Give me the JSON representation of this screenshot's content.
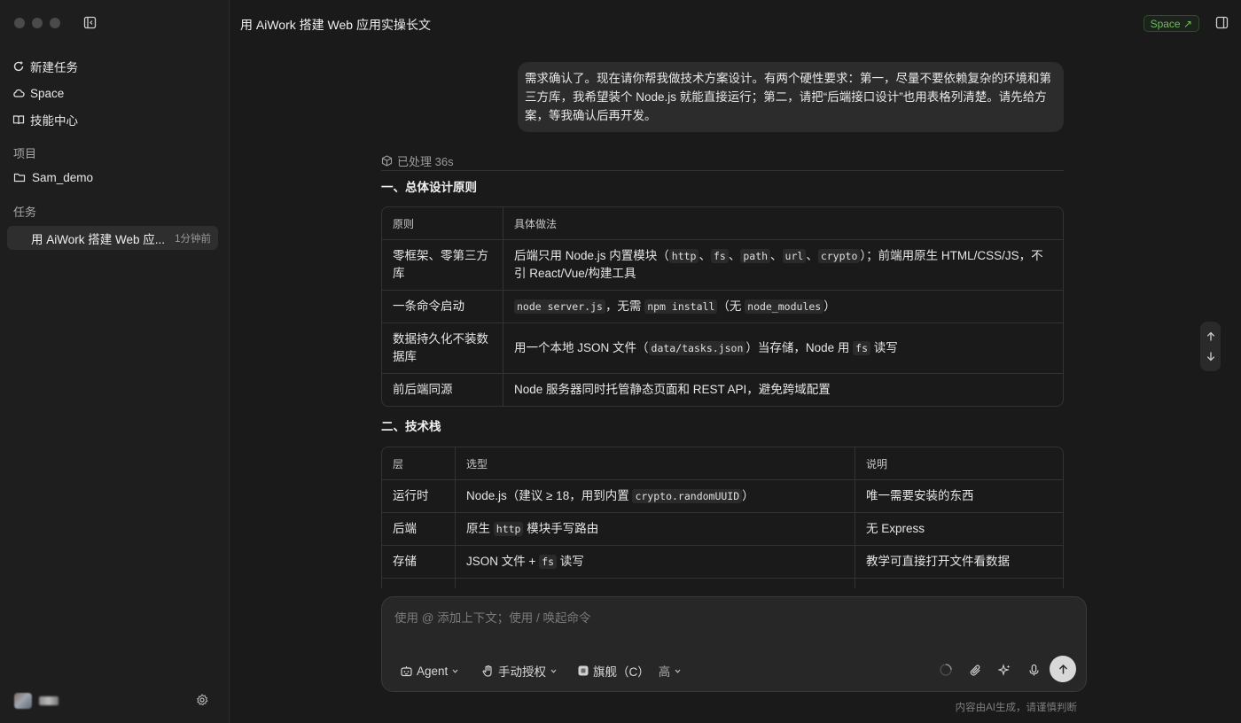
{
  "sidebar": {
    "nav": [
      {
        "label": "新建任务",
        "icon": "new-task-icon"
      },
      {
        "label": "Space",
        "icon": "cloud-icon"
      },
      {
        "label": "技能中心",
        "icon": "book-icon"
      }
    ],
    "projects_label": "项目",
    "project": "Sam_demo",
    "tasks_label": "任务",
    "task": {
      "title": "用 AiWork 搭建 Web 应...",
      "time": "1分钟前"
    }
  },
  "header": {
    "title": "用 AiWork 搭建 Web 应用实操长文",
    "space_label": "Space ↗"
  },
  "chat": {
    "user_message": "需求确认了。现在请你帮我做技术方案设计。有两个硬性要求：第一，尽量不要依赖复杂的环境和第三方库，我希望装个 Node.js 就能直接运行；第二，请把“后端接口设计”也用表格列清楚。请先给方案，等我确认后再开发。",
    "processed": "已处理 36s",
    "section1_title": "一、总体设计原则",
    "table1": {
      "headers": [
        "原则",
        "具体做法"
      ],
      "rows": [
        {
          "c0": "零框架、零第三方库",
          "p1": "后端只用 Node.js 内置模块（",
          "k1": "http",
          "s1": "、",
          "k2": "fs",
          "s2": "、",
          "k3": "path",
          "s3": "、",
          "k4": "url",
          "s4": "、",
          "k5": "crypto",
          "p2": "）；前端用原生 HTML/CSS/JS，不引 React/Vue/构建工具"
        },
        {
          "c0": "一条命令启动",
          "k1": "node server.js",
          "p1": "，无需 ",
          "k2": "npm install",
          "p2": "（无 ",
          "k3": "node_modules",
          "p3": "）"
        },
        {
          "c0": "数据持久化不装数据库",
          "p1": "用一个本地 JSON 文件（",
          "k1": "data/tasks.json",
          "p2": "）当存储，Node 用 ",
          "k2": "fs",
          "p3": " 读写"
        },
        {
          "c0": "前后端同源",
          "p1": "Node 服务器同时托管静态页面和 REST API，避免跨域配置"
        }
      ]
    },
    "section2_title": "二、技术栈",
    "table2": {
      "headers": [
        "层",
        "选型",
        "说明"
      ],
      "rows": [
        {
          "c0": "运行时",
          "p1": "Node.js（建议 ≥ 18，用到内置 ",
          "k1": "crypto.randomUUID",
          "p2": "）",
          "c2": "唯一需要安装的东西"
        },
        {
          "c0": "后端",
          "p1": "原生 ",
          "k1": "http",
          "p2": " 模块手写路由",
          "c2": "无 Express"
        },
        {
          "c0": "存储",
          "p1": "JSON 文件 + ",
          "k1": "fs",
          "p2": " 读写",
          "c2": "教学可直接打开文件看数据"
        }
      ]
    }
  },
  "composer": {
    "placeholder": "使用 @ 添加上下文；使用 / 唤起命令",
    "agent_label": "Agent",
    "auth_label": "手动授权",
    "model_label": "旗舰（C）",
    "level_label": "高"
  },
  "footer": {
    "disclaimer": "内容由AI生成，请谨慎判断"
  },
  "colors": {
    "accent_green": "#6fbf5a",
    "background": "#1a1a1a",
    "sidebar": "#1e1e1e"
  }
}
